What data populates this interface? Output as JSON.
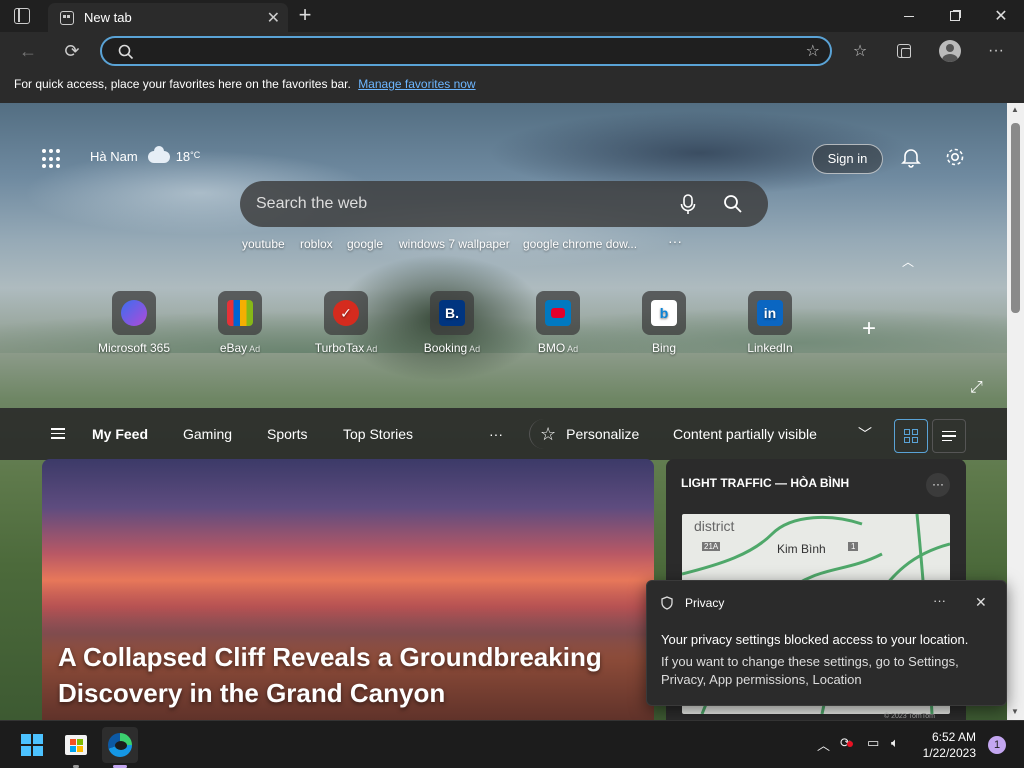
{
  "browser": {
    "tab_title": "New tab",
    "favbar_text": "For quick access, place your favorites here on the favorites bar.",
    "favbar_link": "Manage favorites now",
    "omnibox_value": ""
  },
  "newtab": {
    "location": "Hà Nam",
    "temperature": "18",
    "temp_unit": "°C",
    "sign_in": "Sign in",
    "search_placeholder": "Search the web",
    "suggestions": [
      "youtube",
      "roblox",
      "google",
      "windows 7 wallpaper",
      "google chrome dow...",
      "···"
    ],
    "tiles": [
      {
        "label": "Microsoft 365",
        "ad": ""
      },
      {
        "label": "eBay",
        "ad": "Ad"
      },
      {
        "label": "TurboTax",
        "ad": "Ad"
      },
      {
        "label": "Booking",
        "ad": "Ad"
      },
      {
        "label": "BMO",
        "ad": "Ad"
      },
      {
        "label": "Bing",
        "ad": ""
      },
      {
        "label": "LinkedIn",
        "ad": ""
      }
    ],
    "tile_glyphs": {
      "booking": "B.",
      "linkedin": "in"
    }
  },
  "feed": {
    "nav": [
      "My Feed",
      "Gaming",
      "Sports",
      "Top Stories"
    ],
    "more": "···",
    "personalize": "Personalize",
    "content_visibility": "Content partially visible",
    "hero_headline": "A Collapsed Cliff Reveals a Groundbreaking Discovery in the Grand Canyon",
    "traffic_title": "LIGHT TRAFFIC — HÒA BÌNH",
    "map_labels": [
      "district",
      "Kim Bình",
      "21A",
      "1"
    ],
    "map_copyright": "© 2023 TomTom"
  },
  "privacy_toast": {
    "title": "Privacy",
    "line1": "Your privacy settings blocked access to your location.",
    "line2": "If you want to change these settings, go to Settings, Privacy, App permissions, Location"
  },
  "taskbar": {
    "time": "6:52 AM",
    "date": "1/22/2023",
    "notification_count": "1"
  },
  "colors": {
    "accent": "#5aa3d6",
    "link": "#6cb6ff",
    "badge": "#c3a6f0"
  }
}
